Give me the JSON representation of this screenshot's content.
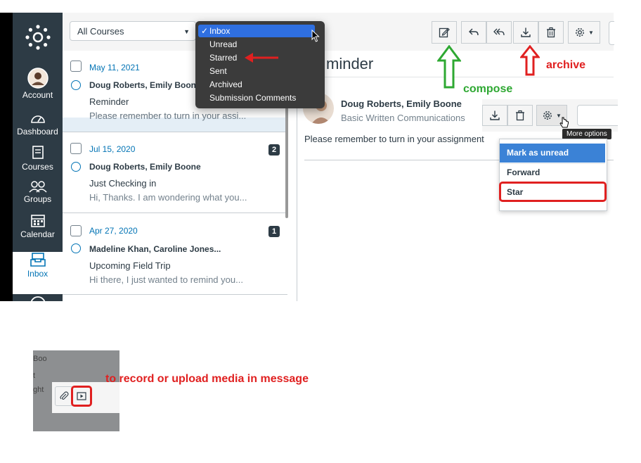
{
  "nav": {
    "account": "Account",
    "dashboard": "Dashboard",
    "courses": "Courses",
    "groups": "Groups",
    "calendar": "Calendar",
    "inbox": "Inbox"
  },
  "toolbar": {
    "course_filter": "All Courses"
  },
  "mailbox_menu": {
    "items": [
      "Inbox",
      "Unread",
      "Starred",
      "Sent",
      "Archived",
      "Submission Comments"
    ],
    "selected_mark": "✓"
  },
  "messages": [
    {
      "date": "May 11, 2021",
      "who": "Doug Roberts, Emily Boone",
      "subject": "Reminder",
      "preview": "Please remember to turn in your assi...",
      "count": ""
    },
    {
      "date": "Jul 15, 2020",
      "who": "Doug Roberts, Emily Boone",
      "subject": "Just Checking in",
      "preview": "Hi, Thanks. I am wondering what you...",
      "count": "2"
    },
    {
      "date": "Apr 27, 2020",
      "who": "Madeline Khan, Caroline Jones...",
      "subject": "Upcoming Field Trip",
      "preview": "Hi there, I just wanted to remind you...",
      "count": "1"
    }
  ],
  "detail": {
    "title": "minder",
    "participants": "Doug Roberts, Emily Boone",
    "course": "Basic Written Communications",
    "body": "Please remember to turn in your assignment"
  },
  "more_options": {
    "tooltip": "More options",
    "items": [
      "Mark as unread",
      "Forward",
      "Star"
    ]
  },
  "media_snippet": {
    "fragment_1": "Boo",
    "fragment_2": "t",
    "fragment_3": "ght"
  },
  "annotations": {
    "compose": "compose",
    "archive": "archive",
    "media": "to record or upload media in message"
  },
  "colors": {
    "nav_bg": "#2d3b45",
    "link_blue": "#0374b5",
    "annot_red": "#e02020",
    "annot_green": "#2ea832",
    "menu_sel": "#2f6fe0",
    "option_sel": "#3b82d6"
  }
}
